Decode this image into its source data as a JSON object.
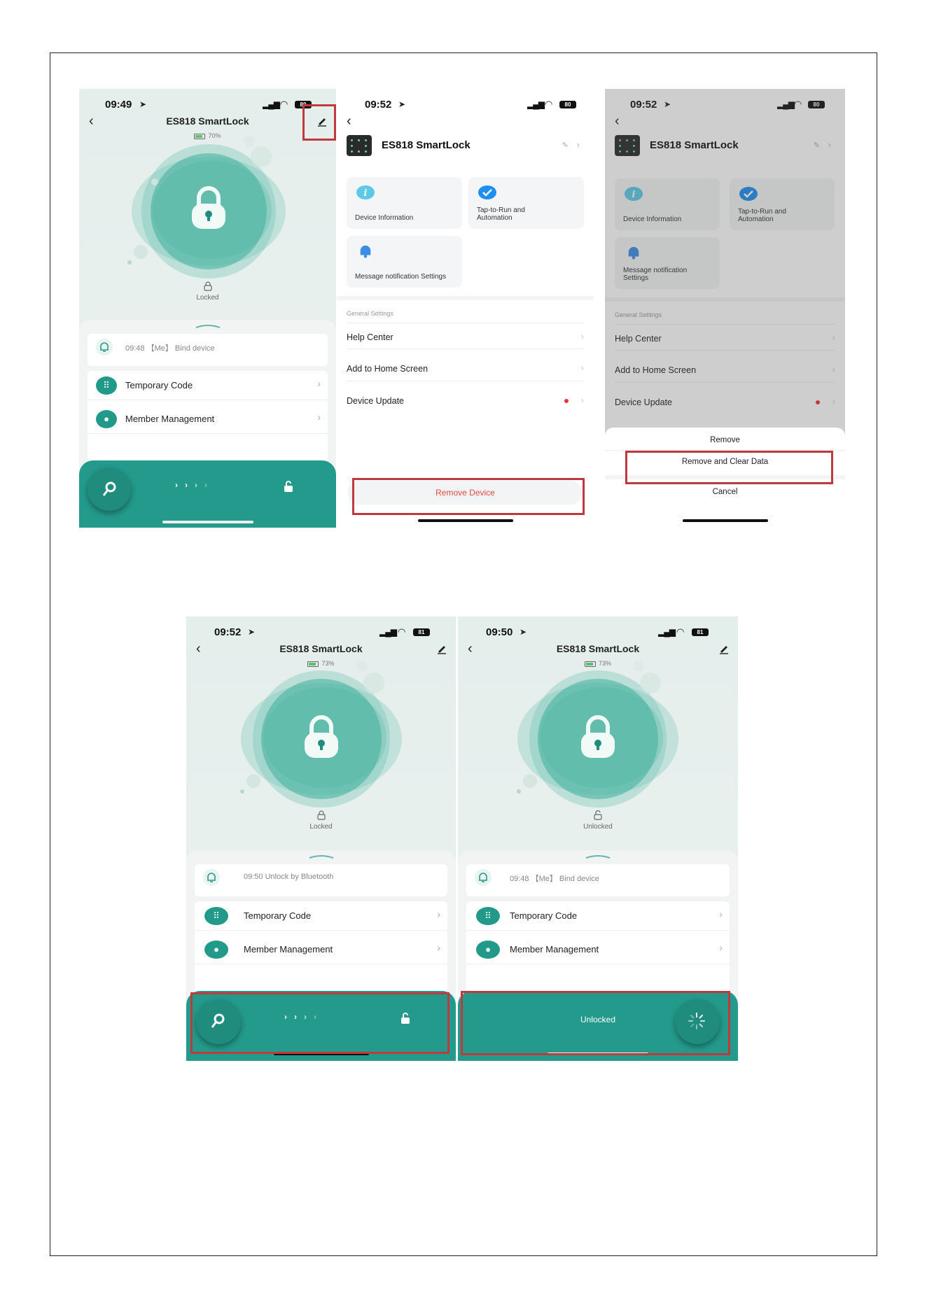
{
  "screens": [
    {
      "id": "home-1",
      "status": {
        "time": "09:49",
        "battery": "80"
      },
      "title": "ES818 SmartLock",
      "battery_label": "70%",
      "lock_state": "Locked",
      "history": "09:48 【Me】 Bind device",
      "menu": [
        {
          "label": "Temporary Code"
        },
        {
          "label": "Member Management"
        }
      ]
    },
    {
      "id": "settings",
      "status": {
        "time": "09:52",
        "battery": "80"
      },
      "device_name": "ES818 SmartLock",
      "tiles": [
        {
          "label": "Device Information"
        },
        {
          "label": "Tap-to-Run and Automation"
        },
        {
          "label": "Message notification Settings"
        }
      ],
      "general_settings_header": "General Settings",
      "rows": [
        {
          "label": "Help Center"
        },
        {
          "label": "Add to Home Screen"
        },
        {
          "label": "Device Update"
        }
      ],
      "remove_button": "Remove Device"
    },
    {
      "id": "settings-dialog",
      "status": {
        "time": "09:52",
        "battery": "80"
      },
      "sheet": {
        "title": "Remove",
        "primary": "Remove and Clear Data",
        "cancel": "Cancel"
      }
    },
    {
      "id": "home-2",
      "status": {
        "time": "09:52",
        "battery": "81"
      },
      "title": "ES818 SmartLock",
      "battery_label": "73%",
      "lock_state": "Locked",
      "history": "09:50 Unlock by Bluetooth",
      "menu": [
        {
          "label": "Temporary Code"
        },
        {
          "label": "Member Management"
        }
      ]
    },
    {
      "id": "home-3",
      "status": {
        "time": "09:50",
        "battery": "81"
      },
      "title": "ES818 SmartLock",
      "battery_label": "73%",
      "lock_state": "Unlocked",
      "history": "09:48 【Me】 Bind device",
      "menu": [
        {
          "label": "Temporary Code"
        },
        {
          "label": "Member Management"
        }
      ],
      "slider_state": "Unlocked"
    }
  ],
  "colors": {
    "teal": "#239a8b",
    "highlight": "#c0393b",
    "danger": "#e04a3c"
  },
  "icons": [
    "location-arrow-icon",
    "signal-icon",
    "wifi-icon",
    "battery-icon",
    "back-icon",
    "edit-icon",
    "padlock-icon",
    "bell-icon",
    "keypad-icon",
    "person-icon",
    "key-icon",
    "unlock-icon",
    "info-icon",
    "checkmark-icon",
    "spinner-icon"
  ]
}
